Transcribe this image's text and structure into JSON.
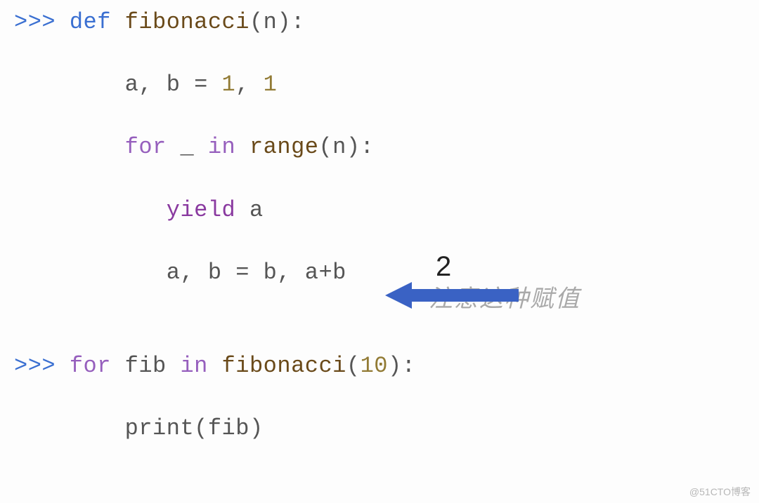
{
  "code": {
    "prompt": ">>> ",
    "kw_def": "def",
    "kw_for": "for",
    "kw_in": "in",
    "kw_yield": "yield",
    "fn_fibonacci": "fibonacci",
    "fn_range": "range",
    "fn_print": "print",
    "id_n": "n",
    "id_a": "a",
    "id_b": "b",
    "id_underscore": "_",
    "id_fib": "fib",
    "num_1a": "1",
    "num_1b": "1",
    "num_10": "10",
    "line1_tail": "(n):",
    "line2_lhs": "a, b = ",
    "comma_sp": ", ",
    "line3_mid": " _ ",
    "line3_tail": "(n):",
    "line4_sp": " ",
    "line5_lhs": "a, b = b, a+b",
    "line6_tail": "):",
    "line7_call": "print(fib)",
    "colon": ":",
    "open_p": "(",
    "close_p": ")"
  },
  "annotation": {
    "number_label": "2",
    "hint_text": "注意这种赋值"
  },
  "footer": {
    "watermark": "@51CTO博客"
  },
  "colors": {
    "prompt_blue": "#3a6fd1",
    "keyword_purple": "#965fbd",
    "yield_purple": "#8a3aa0",
    "fn_brown": "#6a4a1a",
    "num_olive": "#927b35",
    "arrow_blue": "#3a62c4",
    "text_gray": "#555555",
    "hint_gray": "#a9a9a9"
  }
}
